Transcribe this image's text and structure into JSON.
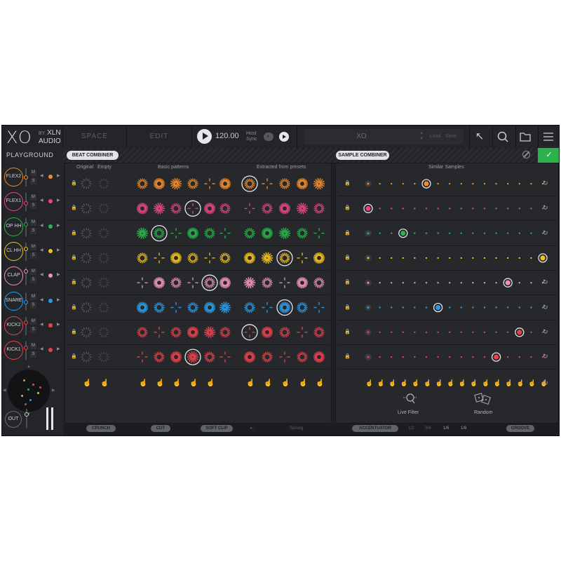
{
  "header": {
    "logo_symbol": "XO",
    "logo_by": "BY",
    "brand_line1": "XLN",
    "brand_line2": "AUDIO",
    "nav": [
      "SPACE",
      "EDIT"
    ],
    "tempo": "120.00",
    "host_sync_label": "Host Sync",
    "sync_toggle_label": "◐",
    "preset_name": "XO",
    "preset_load": "Load",
    "preset_save": "Save",
    "icons": [
      "arrow-up-left-icon",
      "search-icon",
      "folder-icon",
      "menu-icon"
    ]
  },
  "subbar": {
    "title": "PLAYGROUND",
    "beat_combiner": "BEAT COMBINER",
    "sample_combiner": "SAMPLE COMBINER",
    "confirm_label": "✓"
  },
  "channels": [
    {
      "name": "FLEX2",
      "color": "#f08a2a",
      "knob": 0.45,
      "sample_step": 5,
      "pattern_sel": 8,
      "sel_style": "mid"
    },
    {
      "name": "FLEX1",
      "color": "#e5467f",
      "knob": 0.55,
      "sample_step": 0,
      "pattern_sel": 5,
      "sel_style": "sparse"
    },
    {
      "name": "OP HH",
      "color": "#2bb24c",
      "knob": 0.3,
      "sample_step": 3,
      "pattern_sel": 3,
      "sel_style": "dense"
    },
    {
      "name": "CL HH",
      "color": "#f2c21b",
      "knob": 0.3,
      "sample_step": 15,
      "pattern_sel": 10,
      "sel_style": "burst"
    },
    {
      "name": "CLAP",
      "color": "#ee93b4",
      "knob": 0.15,
      "sample_step": 12,
      "pattern_sel": 6,
      "sel_style": "sparse"
    },
    {
      "name": "SNARE",
      "color": "#2d9ae6",
      "knob": 0.5,
      "sample_step": 6,
      "pattern_sel": 10,
      "sel_style": "mid"
    },
    {
      "name": "KICK2",
      "color": "#e8414d",
      "knob": 0.25,
      "sample_step": 13,
      "pattern_sel": 8,
      "sel_style": "mid"
    },
    {
      "name": "KICK1",
      "color": "#e8414d",
      "knob": 0.25,
      "sample_step": 11,
      "pattern_sel": 5,
      "sel_style": "sparse"
    }
  ],
  "mute_label": "M",
  "solo_label": "S",
  "out_label": "OUT",
  "xy_pad_arrows": [
    "◀",
    "▶",
    "▲",
    "▼"
  ],
  "beat_panel": {
    "labels": [
      "Original",
      "Empty",
      "Basic patterns",
      "Extracted from presets"
    ]
  },
  "sample_panel": {
    "label": "Similar Samples",
    "steps": 16,
    "live_filter": "Live Filter",
    "random": "Random"
  },
  "bottom": {
    "crunch": "CRUNCH",
    "cut": "CUT",
    "soft_clip": "SOFT CLIP",
    "sprung_prefix": "◂ ◦",
    "sprung": "Sprung",
    "accentuator": "ACCENTUATOR",
    "divisions": [
      "1/2",
      "3/4",
      "1/6",
      "1/8"
    ],
    "groove": "GROOVE"
  },
  "colors": {
    "background": "#1f2124",
    "panel": "#26282c",
    "accent_green": "#2bb24c"
  }
}
